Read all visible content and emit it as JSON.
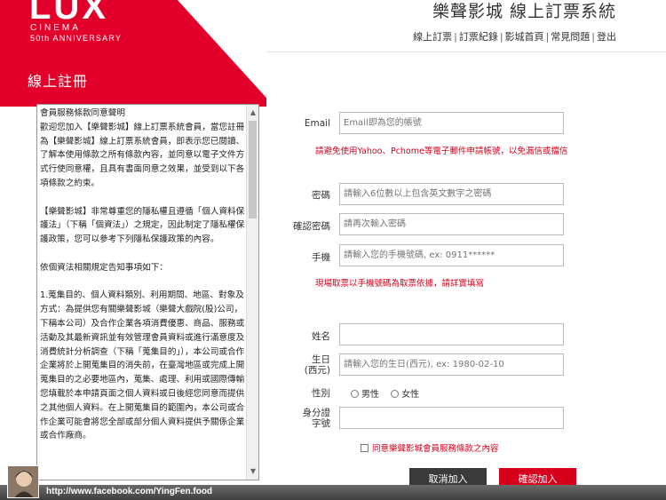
{
  "brand": {
    "logo_text": "LUX",
    "logo_sub1": "CINEMA",
    "logo_sub2": "50th ANNIVERSARY",
    "red": "#e2002a"
  },
  "header": {
    "site_title": "樂聲影城 線上訂票系統",
    "page_title": "線上註冊",
    "nav": [
      "線上訂票",
      "訂票紀錄",
      "影城首頁",
      "常見問題",
      "登出"
    ]
  },
  "terms": {
    "paragraphs": [
      "會員服務條款同意聲明\n歡迎您加入【樂聲影城】線上訂票系統會員，當您註冊為【樂聲影城】線上訂票系統會員，即表示您已閱讀、了解本使用條款之所有條款內容，並同意以電子文件方式行使同意權，且具有書面同意之效果，並受到以下各項條款之約束。",
      "【樂聲影城】非常尊重您的隱私權且遵循「個人資料保護法」（下稱「個資法」）之規定，因此制定了隱私權保護政策，您可以參考下列隱私保護政策的內容。",
      "依個資法相關規定告知事項如下：",
      "1.蒐集目的、個人資料類別、利用期間、地區、對象及方式：為提供您有關樂聲影城（樂聲大戲院(股)公司，下稱本公司）及合作企業各項消費優惠、商品、服務或活動及其最新資訊並有效管理會員資料或進行滿意度及消費統計分析調查（下稱「蒐集目的」），本公司或合作企業將於上開蒐集目的消失前，在臺灣地區或完成上開蒐集目的之必要地區內，蒐集、處理、利用或國際傳輸您填載於本申請頁面之個人資料或日後經您同意而提供之其他個人資料。在上開蒐集目的範圍內，本公司或合作企業可能會將您全部或部分個人資料提供予關係企業或合作廠商。"
    ]
  },
  "form": {
    "email_label": "Email",
    "email_placeholder": "Email即為您的帳號",
    "email_hint": "請避免使用Yahoo、Pchome等電子郵件申請帳號，以免漏信或擋信",
    "password_label": "密碼",
    "password_placeholder": "請輸入6位數以上包含英文數字之密碼",
    "confirm_label": "確認密碼",
    "confirm_placeholder": "請再次輸入密碼",
    "phone_label": "手機",
    "phone_placeholder": "請輸入您的手機號碼, ex: 0911******",
    "phone_hint": "現場取票以手機號碼為取票依據，請詳實填寫",
    "name_label": "姓名",
    "name_value": "",
    "birthday_label_1": "生日",
    "birthday_label_2": "(西元)",
    "birthday_placeholder": "請輸入您的生日(西元), ex: 1980-02-10",
    "gender_label": "性別",
    "gender_male": "男性",
    "gender_female": "女性",
    "id_label_1": "身分證",
    "id_label_2": "字號",
    "id_value": "",
    "agree_text": "同意樂聲影城會員服務條款之內容"
  },
  "buttons": {
    "cancel": "取消加入",
    "confirm": "確認加入"
  },
  "watermark": {
    "url": "http://www.facebook.com/YingFen.food"
  }
}
